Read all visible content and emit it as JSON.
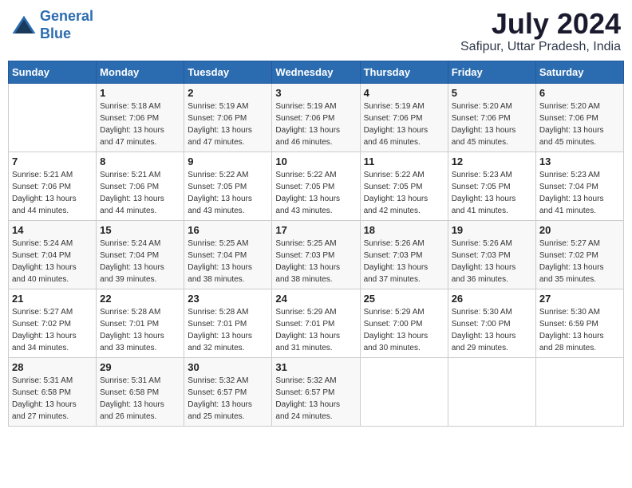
{
  "logo": {
    "line1": "General",
    "line2": "Blue"
  },
  "title": "July 2024",
  "subtitle": "Safipur, Uttar Pradesh, India",
  "days_header": [
    "Sunday",
    "Monday",
    "Tuesday",
    "Wednesday",
    "Thursday",
    "Friday",
    "Saturday"
  ],
  "weeks": [
    [
      {
        "num": "",
        "info": ""
      },
      {
        "num": "1",
        "info": "Sunrise: 5:18 AM\nSunset: 7:06 PM\nDaylight: 13 hours\nand 47 minutes."
      },
      {
        "num": "2",
        "info": "Sunrise: 5:19 AM\nSunset: 7:06 PM\nDaylight: 13 hours\nand 47 minutes."
      },
      {
        "num": "3",
        "info": "Sunrise: 5:19 AM\nSunset: 7:06 PM\nDaylight: 13 hours\nand 46 minutes."
      },
      {
        "num": "4",
        "info": "Sunrise: 5:19 AM\nSunset: 7:06 PM\nDaylight: 13 hours\nand 46 minutes."
      },
      {
        "num": "5",
        "info": "Sunrise: 5:20 AM\nSunset: 7:06 PM\nDaylight: 13 hours\nand 45 minutes."
      },
      {
        "num": "6",
        "info": "Sunrise: 5:20 AM\nSunset: 7:06 PM\nDaylight: 13 hours\nand 45 minutes."
      }
    ],
    [
      {
        "num": "7",
        "info": "Sunrise: 5:21 AM\nSunset: 7:06 PM\nDaylight: 13 hours\nand 44 minutes."
      },
      {
        "num": "8",
        "info": "Sunrise: 5:21 AM\nSunset: 7:06 PM\nDaylight: 13 hours\nand 44 minutes."
      },
      {
        "num": "9",
        "info": "Sunrise: 5:22 AM\nSunset: 7:05 PM\nDaylight: 13 hours\nand 43 minutes."
      },
      {
        "num": "10",
        "info": "Sunrise: 5:22 AM\nSunset: 7:05 PM\nDaylight: 13 hours\nand 43 minutes."
      },
      {
        "num": "11",
        "info": "Sunrise: 5:22 AM\nSunset: 7:05 PM\nDaylight: 13 hours\nand 42 minutes."
      },
      {
        "num": "12",
        "info": "Sunrise: 5:23 AM\nSunset: 7:05 PM\nDaylight: 13 hours\nand 41 minutes."
      },
      {
        "num": "13",
        "info": "Sunrise: 5:23 AM\nSunset: 7:04 PM\nDaylight: 13 hours\nand 41 minutes."
      }
    ],
    [
      {
        "num": "14",
        "info": "Sunrise: 5:24 AM\nSunset: 7:04 PM\nDaylight: 13 hours\nand 40 minutes."
      },
      {
        "num": "15",
        "info": "Sunrise: 5:24 AM\nSunset: 7:04 PM\nDaylight: 13 hours\nand 39 minutes."
      },
      {
        "num": "16",
        "info": "Sunrise: 5:25 AM\nSunset: 7:04 PM\nDaylight: 13 hours\nand 38 minutes."
      },
      {
        "num": "17",
        "info": "Sunrise: 5:25 AM\nSunset: 7:03 PM\nDaylight: 13 hours\nand 38 minutes."
      },
      {
        "num": "18",
        "info": "Sunrise: 5:26 AM\nSunset: 7:03 PM\nDaylight: 13 hours\nand 37 minutes."
      },
      {
        "num": "19",
        "info": "Sunrise: 5:26 AM\nSunset: 7:03 PM\nDaylight: 13 hours\nand 36 minutes."
      },
      {
        "num": "20",
        "info": "Sunrise: 5:27 AM\nSunset: 7:02 PM\nDaylight: 13 hours\nand 35 minutes."
      }
    ],
    [
      {
        "num": "21",
        "info": "Sunrise: 5:27 AM\nSunset: 7:02 PM\nDaylight: 13 hours\nand 34 minutes."
      },
      {
        "num": "22",
        "info": "Sunrise: 5:28 AM\nSunset: 7:01 PM\nDaylight: 13 hours\nand 33 minutes."
      },
      {
        "num": "23",
        "info": "Sunrise: 5:28 AM\nSunset: 7:01 PM\nDaylight: 13 hours\nand 32 minutes."
      },
      {
        "num": "24",
        "info": "Sunrise: 5:29 AM\nSunset: 7:01 PM\nDaylight: 13 hours\nand 31 minutes."
      },
      {
        "num": "25",
        "info": "Sunrise: 5:29 AM\nSunset: 7:00 PM\nDaylight: 13 hours\nand 30 minutes."
      },
      {
        "num": "26",
        "info": "Sunrise: 5:30 AM\nSunset: 7:00 PM\nDaylight: 13 hours\nand 29 minutes."
      },
      {
        "num": "27",
        "info": "Sunrise: 5:30 AM\nSunset: 6:59 PM\nDaylight: 13 hours\nand 28 minutes."
      }
    ],
    [
      {
        "num": "28",
        "info": "Sunrise: 5:31 AM\nSunset: 6:58 PM\nDaylight: 13 hours\nand 27 minutes."
      },
      {
        "num": "29",
        "info": "Sunrise: 5:31 AM\nSunset: 6:58 PM\nDaylight: 13 hours\nand 26 minutes."
      },
      {
        "num": "30",
        "info": "Sunrise: 5:32 AM\nSunset: 6:57 PM\nDaylight: 13 hours\nand 25 minutes."
      },
      {
        "num": "31",
        "info": "Sunrise: 5:32 AM\nSunset: 6:57 PM\nDaylight: 13 hours\nand 24 minutes."
      },
      {
        "num": "",
        "info": ""
      },
      {
        "num": "",
        "info": ""
      },
      {
        "num": "",
        "info": ""
      }
    ]
  ]
}
